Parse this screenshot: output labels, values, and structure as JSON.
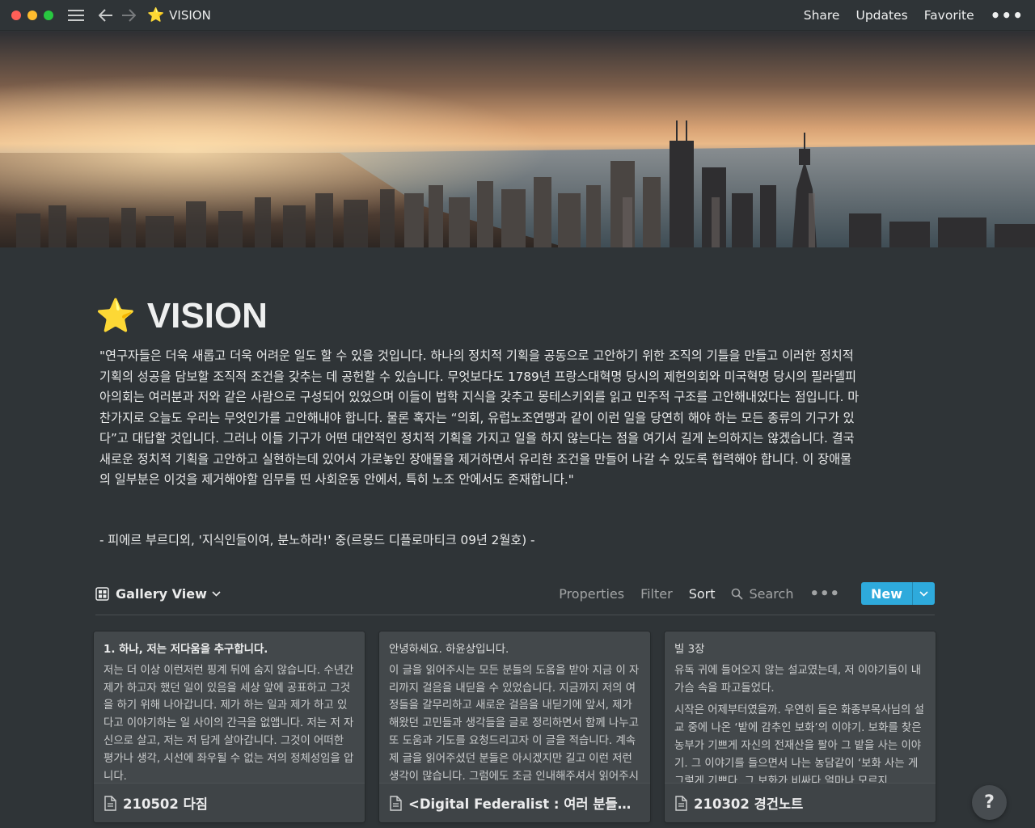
{
  "window": {
    "page_title": "VISION",
    "page_emoji": "⭐",
    "share_label": "Share",
    "updates_label": "Updates",
    "favorite_label": "Favorite",
    "more_label": "•••"
  },
  "page": {
    "title": "VISION",
    "emoji": "⭐",
    "quote": "\"연구자들은 더욱 새롭고 더욱 어려운 일도 할 수 있을 것입니다. 하나의 정치적 기획을 공동으로 고안하기 위한 조직의 기틀을 만들고 이러한 정치적 기획의 성공을 담보할 조직적 조건을 갖추는 데 공헌할 수 있습니다. 무엇보다도 1789년 프랑스대혁명 당시의 제헌의회와 미국혁명 당시의 필라델피아의회는 여러분과 저와 같은 사람으로 구성되어 있었으며 이들이 법학 지식을 갖추고 몽테스키외를 읽고 민주적 구조를 고안해내었다는 점입니다. 마찬가지로 오늘도 우리는 무엇인가를 고안해내야 합니다. 물론 혹자는 “의회, 유럽노조연맹과 같이 이런 일을 당연히 해야 하는 모든 종류의 기구가 있다”고 대답할 것입니다. 그러나 이들 기구가 어떤 대안적인 정치적 기획을 가지고 일을 하지 않는다는 점을 여기서 길게 논의하지는 않겠습니다. 결국 새로운 정치적 기획을 고안하고 실현하는데 있어서 가로놓인 장애물을 제거하면서 유리한 조건을 만들어 나갈 수 있도록 협력해야 합니다. 이 장애물의 일부분은 이것을 제거해야할 임무를 띤 사회운동 안에서, 특히 노조 안에서도 존재합니다.\"",
    "attribution": "- 피에르 부르디외, '지식인들이여, 분노하라!' 중(르몽드 디플로마티크 09년 2월호) -"
  },
  "view": {
    "name": "Gallery View",
    "properties_label": "Properties",
    "filter_label": "Filter",
    "sort_label": "Sort",
    "search_label": "Search",
    "more_label": "•••",
    "new_label": "New"
  },
  "cards": [
    {
      "heading": "1. 하나, 저는 저다움을 추구합니다.",
      "body": "저는 더 이상 이런저런 핑계 뒤에 숨지 않습니다. 수년간 제가 하고자 했던 일이 있음을 세상 앞에 공표하고 그것을 하기 위해 나아갑니다. 제가 하는 일과 제가 하고 있다고 이야기하는 일 사이의 간극을 없앱니다. 저는 저 자신으로 살고, 저는 저 답게 살아갑니다. 그것이 어떠한 평가나 생각, 시선에 좌우될 수 없는 저의 정체성임을 압니다.",
      "title": "210502 다짐"
    },
    {
      "heading": "안녕하세요. 하윤상입니다.",
      "body": " 이 글을 읽어주시는 모든 분들의 도움을 받아 지금 이 자리까지 걸음을 내딛을 수 있었습니다. 지금까지 저의 여정들을 갈무리하고 새로운 걸음을 내딛기에 앞서, 제가 해왔던 고민들과 생각들을 글로 정리하면서 함께 나누고 또 도움과 기도를 요청드리고자 이 글을 적습니다. 계속 제 글을 읽어주셨던 분들은 아시겠지만 길고 이런 저런 생각이 많습니다. 그럼에도 조금 인내해주셔서 읽어주시면 감사하겠습니다.",
      "title": "<Digital Federalist : 여러 분들께 드리는 글>"
    },
    {
      "heading": "빌 3장",
      "body": "유독 귀에 들어오지 않는 설교였는데, 저 이야기들이 내 가슴 속을 파고들었다.",
      "body2": "시작은 어제부터였을까. 우연히 들은 화종부목사님의 설교 중에 나온 ‘밭에 감추인 보화’의 이야기. 보화를 찾은 농부가 기쁘게 자신의 전재산을 팔아 그 밭을 사는 이야기. 그 이야기를 들으면서 나는 농담같이 ‘보화 사는 게 그렇게 기쁘다, 그 보화가 비싸다 얼마나 모르지.",
      "title": "210302 경건노트"
    }
  ],
  "help_label": "?"
}
